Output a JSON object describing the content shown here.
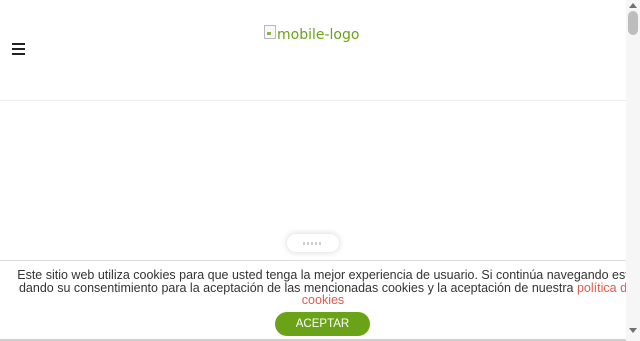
{
  "header": {
    "logo_alt": "mobile-logo",
    "menu_icon": "hamburger-icon"
  },
  "cookie_banner": {
    "text_before_link": "Este sitio web utiliza cookies para que usted tenga la mejor experiencia de usuario. Si continúa navegando est dando su consentimiento para la aceptación de las mencionadas cookies y la aceptación de nuestra ",
    "link_text": "política d cookies",
    "accept_label": "ACEPTAR"
  },
  "colors": {
    "accent": "#6aa317",
    "link": "#e05a4a"
  }
}
